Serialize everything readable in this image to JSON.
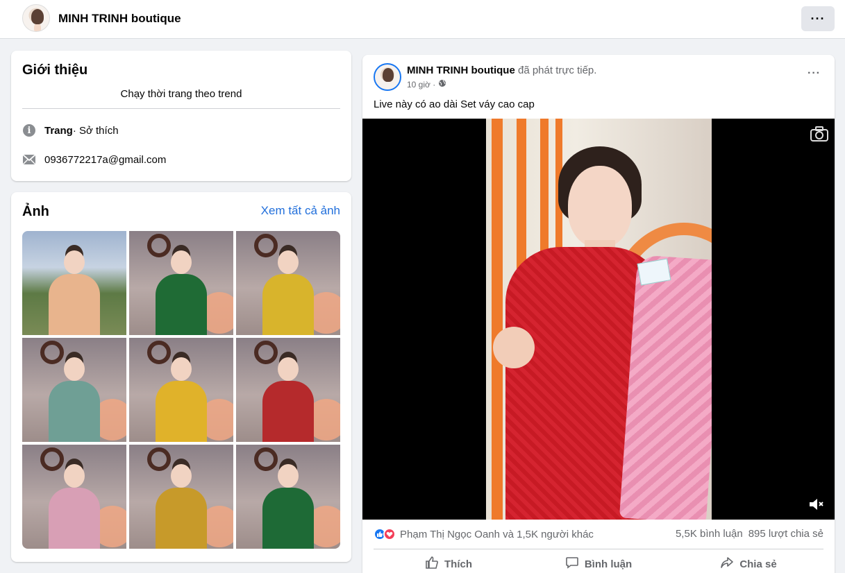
{
  "header": {
    "page_name": "MINH TRINH boutique",
    "more_label": "···"
  },
  "intro": {
    "title": "Giới thiệu",
    "bio": "Chạy thời trang theo trend",
    "category_label": "Trang",
    "category_value": " · Sở thích",
    "email": "0936772217a@gmail.com"
  },
  "photos": {
    "title": "Ảnh",
    "see_all": "Xem tất cả ảnh",
    "items": [
      {
        "dress_color": "#e8b48d",
        "scene": "outdoor"
      },
      {
        "dress_color": "#1f6b35",
        "scene": "studio"
      },
      {
        "dress_color": "#d8b42c",
        "scene": "studio"
      },
      {
        "dress_color": "#6f9f95",
        "scene": "studio"
      },
      {
        "dress_color": "#e0b22a",
        "scene": "studio"
      },
      {
        "dress_color": "#b52a2c",
        "scene": "studio"
      },
      {
        "dress_color": "#d89fb5",
        "scene": "studio"
      },
      {
        "dress_color": "#c79a2a",
        "scene": "studio"
      },
      {
        "dress_color": "#1e6a36",
        "scene": "studio"
      }
    ]
  },
  "post": {
    "author": "MINH TRINH boutique",
    "action": " đã phát trực tiếp.",
    "time": "10 giờ ·",
    "caption": "Live này có ao dài Set váy cao cap",
    "more_label": "···",
    "reactions_text": "Phạm Thị Ngọc Oanh và 1,5K người khác",
    "comments": "5,5K bình luận",
    "shares": "895 lượt chia sẻ",
    "like_label": "Thích",
    "comment_label": "Bình luận",
    "share_label": "Chia sẻ"
  },
  "colors": {
    "accent": "#1877f2",
    "link": "#216fdb",
    "love": "#f33e58",
    "secondary_text": "#65676b"
  }
}
